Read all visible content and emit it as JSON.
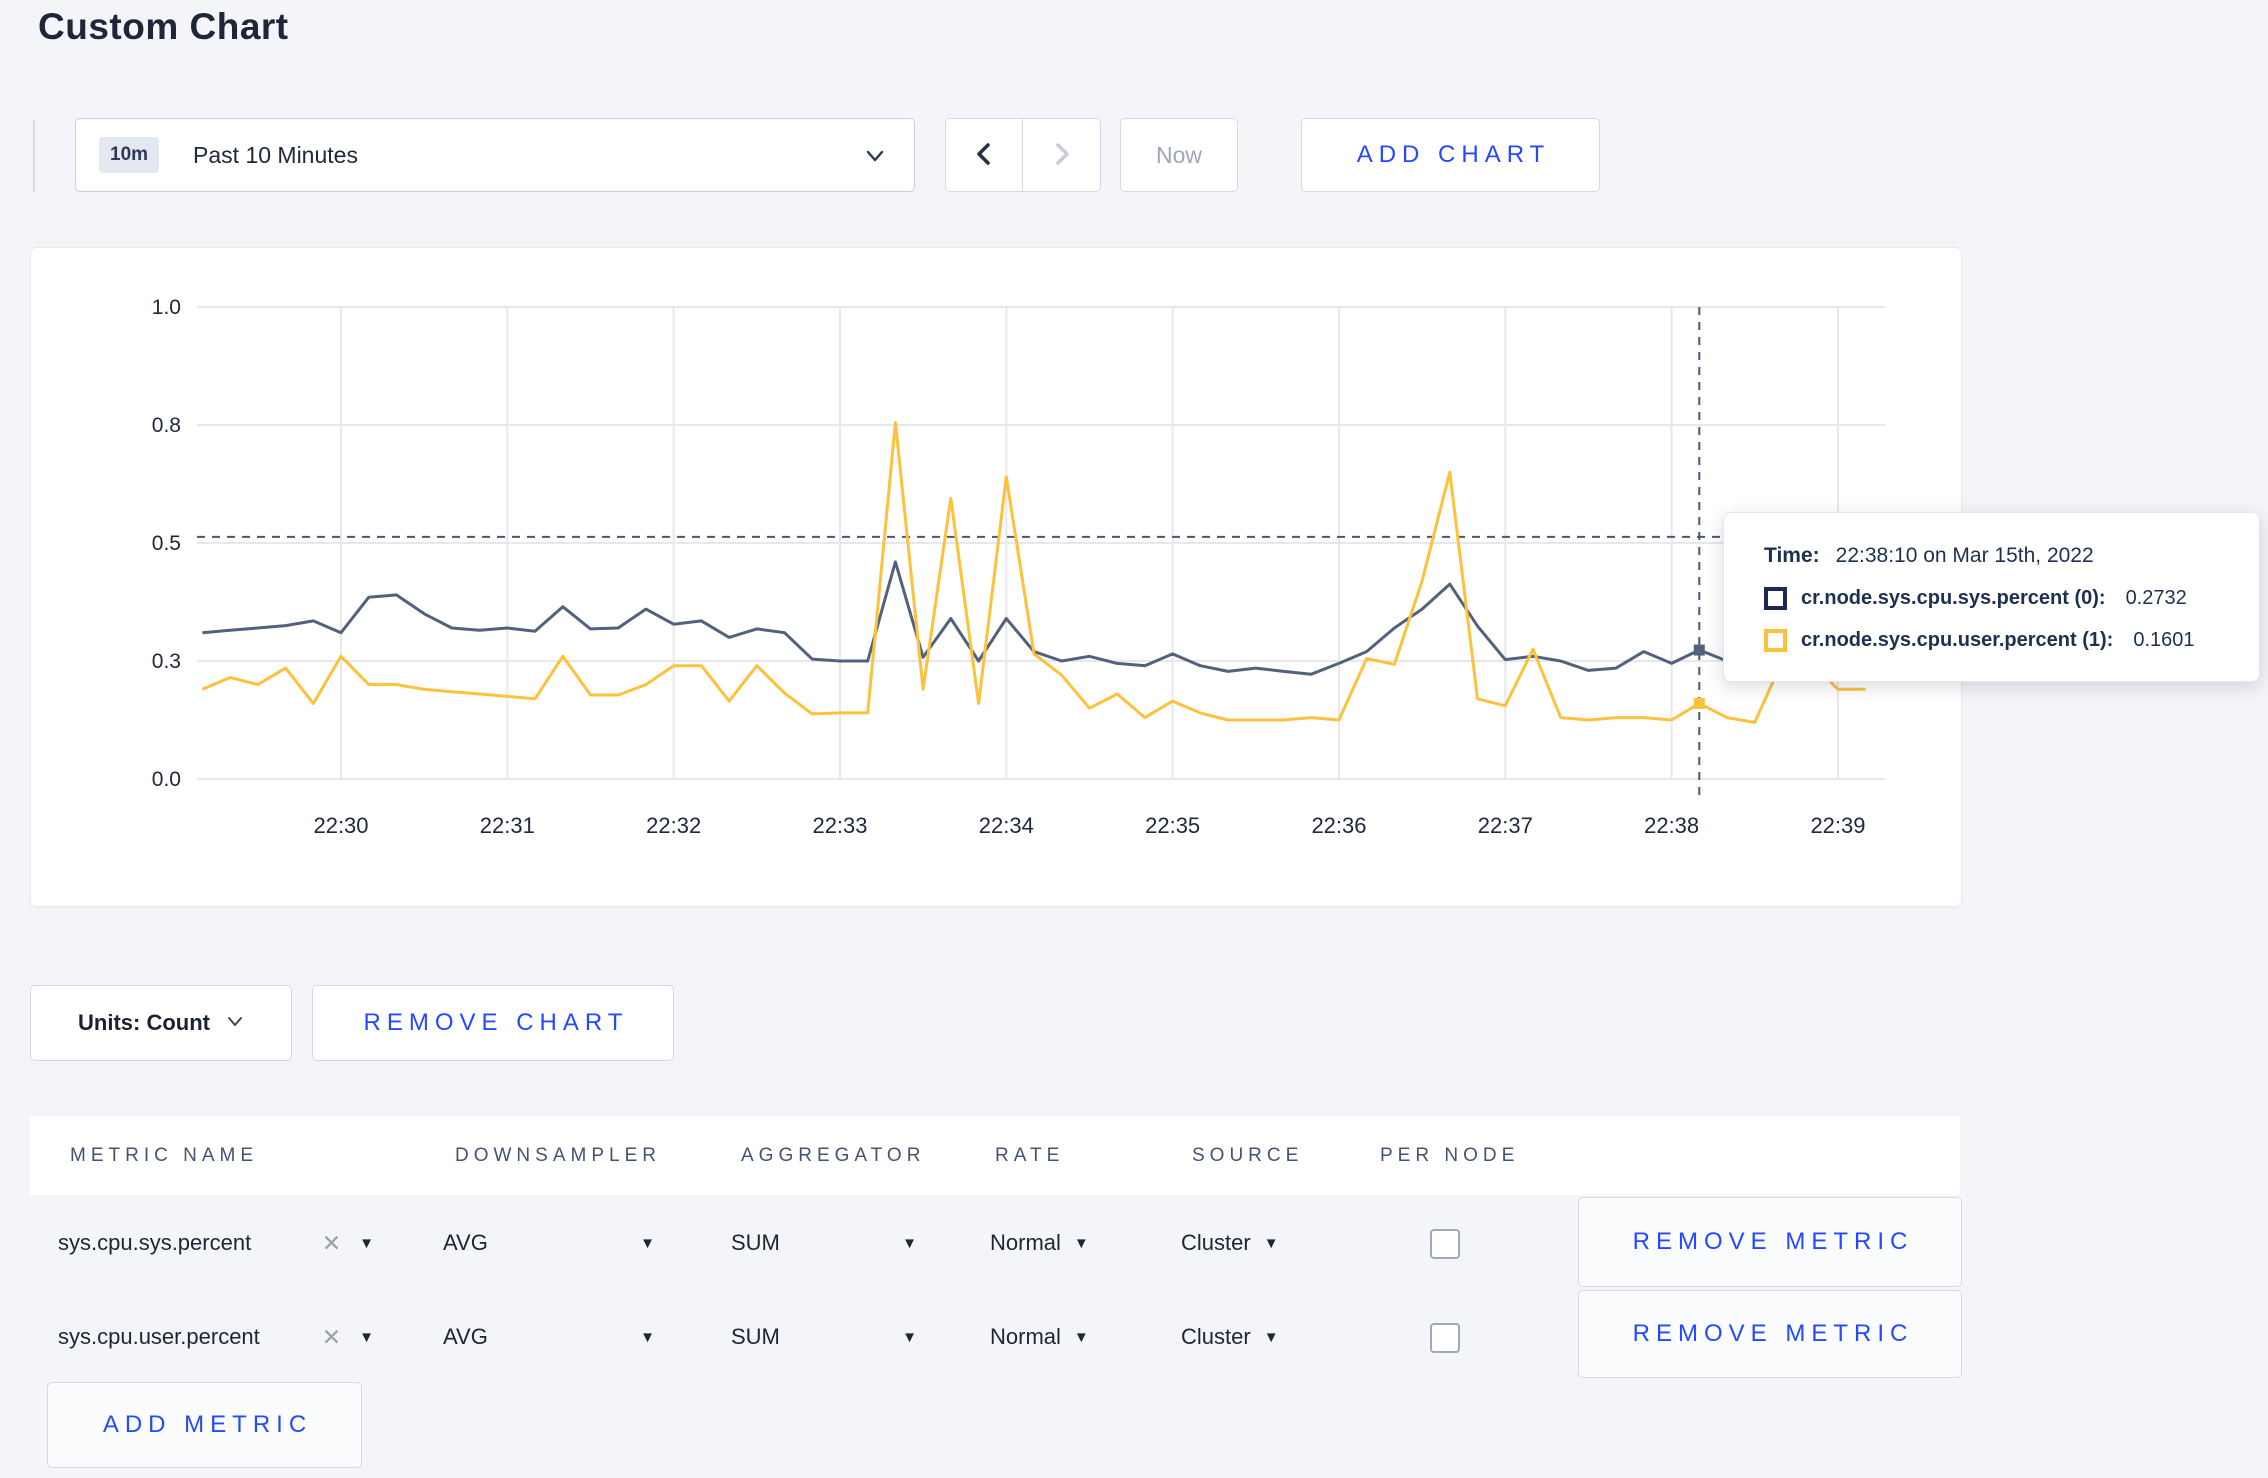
{
  "page": {
    "title": "Custom Chart"
  },
  "colors": {
    "accent_blue": "#2449ff",
    "page_background": "#f4f5f8",
    "grid_line": "#e8e8ec",
    "crosshair": "#44577a",
    "axis_text": "#20283a",
    "series_sys": "#53627c",
    "series_user": "#fdc13c"
  },
  "toolbar": {
    "time_window_badge": "10m",
    "time_window_label": "Past 10 Minutes",
    "now_label": "Now",
    "add_chart_label": "ADD CHART"
  },
  "icons": {
    "dropdown_chevron": "chevron-down",
    "prev": "chevron-left",
    "next": "chevron-right",
    "units_chevron": "chevron-down",
    "remove_tag_glyph": "✕",
    "select_caret_glyph": "▼"
  },
  "chart_data": {
    "type": "line",
    "title": "",
    "xlabel": "",
    "ylabel": "",
    "grid": true,
    "legend_position": "tooltip",
    "x_axis": {
      "tick_labels": [
        "22:30",
        "22:31",
        "22:32",
        "22:33",
        "22:34",
        "22:35",
        "22:36",
        "22:37",
        "22:38",
        "22:39"
      ],
      "start_time": "22:29:10",
      "interval_seconds": 10
    },
    "y_axis": {
      "tick_labels": [
        "0.0",
        "0.3",
        "0.5",
        "0.8",
        "1.0"
      ],
      "tick_values": [
        0,
        0.25,
        0.5,
        0.75,
        1.0
      ],
      "range": [
        0,
        1
      ]
    },
    "series": [
      {
        "name": "cr.node.sys.cpu.sys.percent (0)",
        "color": "#53627c",
        "values": [
          0.31,
          0.315,
          0.32,
          0.325,
          0.335,
          0.31,
          0.385,
          0.39,
          0.35,
          0.32,
          0.315,
          0.32,
          0.313,
          0.365,
          0.318,
          0.32,
          0.36,
          0.328,
          0.335,
          0.3,
          0.318,
          0.31,
          0.254,
          0.25,
          0.25,
          0.46,
          0.258,
          0.34,
          0.25,
          0.34,
          0.27,
          0.25,
          0.26,
          0.245,
          0.24,
          0.265,
          0.24,
          0.228,
          0.235,
          0.228,
          0.222,
          0.245,
          0.27,
          0.32,
          0.36,
          0.413,
          0.324,
          0.253,
          0.26,
          0.25,
          0.23,
          0.235,
          0.27,
          0.245,
          0.2732,
          0.25,
          0.26,
          0.25,
          0.245,
          0.25,
          0.25
        ]
      },
      {
        "name": "cr.node.sys.cpu.user.percent (1)",
        "color": "#fdc13c",
        "values": [
          0.19,
          0.215,
          0.2,
          0.235,
          0.16,
          0.26,
          0.2,
          0.2,
          0.19,
          0.185,
          0.18,
          0.175,
          0.17,
          0.26,
          0.178,
          0.178,
          0.2,
          0.24,
          0.24,
          0.165,
          0.24,
          0.182,
          0.138,
          0.14,
          0.14,
          0.755,
          0.19,
          0.595,
          0.16,
          0.64,
          0.265,
          0.22,
          0.15,
          0.18,
          0.13,
          0.165,
          0.14,
          0.125,
          0.125,
          0.125,
          0.13,
          0.125,
          0.255,
          0.243,
          0.42,
          0.65,
          0.17,
          0.155,
          0.275,
          0.13,
          0.125,
          0.13,
          0.13,
          0.125,
          0.1601,
          0.13,
          0.12,
          0.25,
          0.25,
          0.19,
          0.19
        ]
      }
    ],
    "crosshair": {
      "time": "22:38:10",
      "x_index": 54,
      "y_fraction": 0.513
    }
  },
  "tooltip": {
    "time_label": "Time:",
    "time_value": "22:38:10 on Mar 15th, 2022",
    "series": [
      {
        "label": "cr.node.sys.cpu.sys.percent (0):",
        "value": "0.2732",
        "swatch_color": "#1b2b4d"
      },
      {
        "label": "cr.node.sys.cpu.user.percent (1):",
        "value": "0.1601",
        "swatch_color": "#fdc13c"
      }
    ]
  },
  "chart_controls": {
    "units_label": "Units: Count",
    "remove_chart_label": "REMOVE CHART"
  },
  "metrics_table": {
    "headers": [
      "METRIC NAME",
      "DOWNSAMPLER",
      "AGGREGATOR",
      "RATE",
      "SOURCE",
      "PER NODE"
    ],
    "rows": [
      {
        "metric": "sys.cpu.sys.percent",
        "downsampler": "AVG",
        "aggregator": "SUM",
        "rate": "Normal",
        "source": "Cluster",
        "per_node_checked": false,
        "remove_label": "REMOVE METRIC"
      },
      {
        "metric": "sys.cpu.user.percent",
        "downsampler": "AVG",
        "aggregator": "SUM",
        "rate": "Normal",
        "source": "Cluster",
        "per_node_checked": false,
        "remove_label": "REMOVE METRIC"
      }
    ],
    "add_metric_label": "ADD METRIC"
  }
}
